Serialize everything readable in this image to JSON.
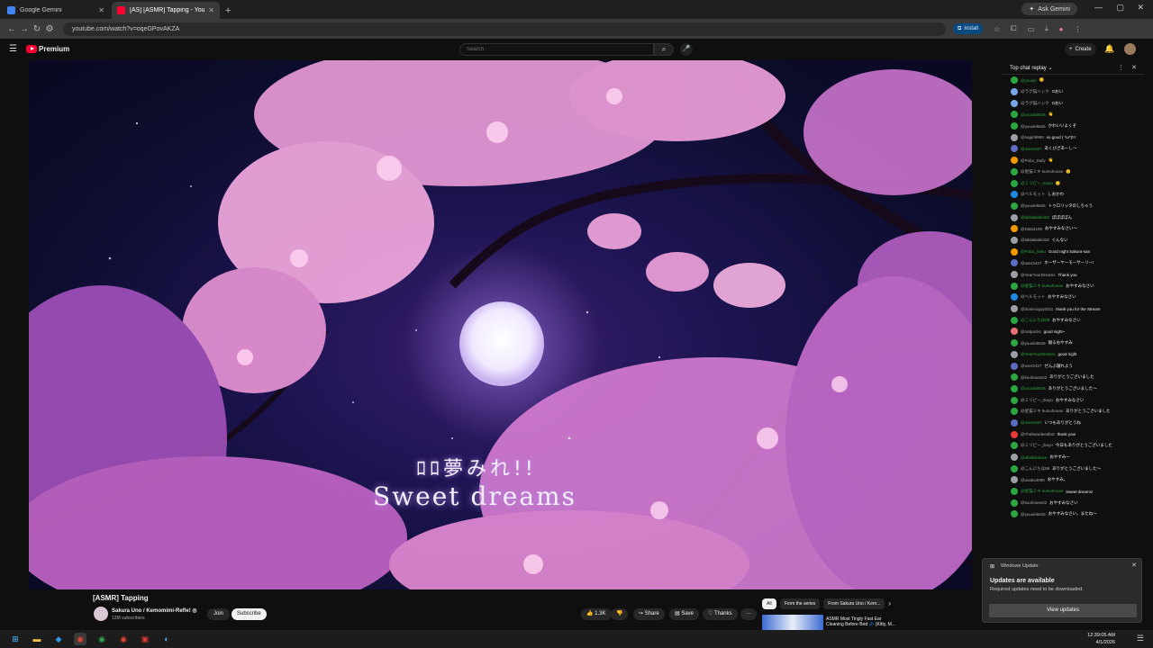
{
  "browser": {
    "tabs": [
      {
        "title": "Google Gemini",
        "color": "#4285f4",
        "active": false
      },
      {
        "title": "[AS] [ASMR] Tapping - YouTube",
        "color": "#ff0033",
        "active": true
      }
    ],
    "new_tab": "+",
    "ask_gemini": "Ask Gemini",
    "url": "youtube.com/watch?v=oqeGPovAKZA",
    "install_label": "Install"
  },
  "youtube": {
    "logo_text": "Premium",
    "search_placeholder": "Search",
    "create_label": "Create"
  },
  "video": {
    "subtitle_jp": "ﾛﾛ夢みれ!!",
    "subtitle_en": "Sweet dreams",
    "title": "[ASMR] Tapping",
    "channel": "Sakura Uno / Kemomimi-Refle!",
    "channel_badge": "◎",
    "subscribers": "12M subscribers",
    "join_label": "Join",
    "subscribe_label": "Subscribe",
    "likes": "1.3K",
    "share_label": "Share",
    "save_label": "Save",
    "thanks_label": "Thanks",
    "more_label": "···"
  },
  "recommendations": {
    "chips": [
      "All",
      "From the series",
      "From Sakura Uno / Kem..."
    ],
    "first_title": "ASMR Most Tingly Fast Ear Cleaning Before Bed 💤 [Kitty, M..."
  },
  "chat": {
    "header": "Top chat replay",
    "messages": [
      {
        "user": "@yuuuki",
        "text": "😊",
        "color": "#2ba640"
      },
      {
        "user": "@ラグ猫ハック",
        "text": "Gおい",
        "color": "#7aa4e8"
      },
      {
        "user": "@ラグ猫ハック",
        "text": "Gおい",
        "color": "#7aa4e8"
      },
      {
        "user": "@yuuuki6626",
        "text": "👋",
        "color": "#2ba640"
      },
      {
        "user": "@yuuuki6626",
        "text": "かわいいよくぞ",
        "color": "#2ba640"
      },
      {
        "user": "@nagiri9999",
        "text": "so good ( *ω*)!!!",
        "color": "#9aa0a6"
      },
      {
        "user": "@user2427",
        "text": "あくびざあーし～",
        "color": "#5c6bc0"
      },
      {
        "user": "@Pobo_Daily",
        "text": "👋",
        "color": "#f29900"
      },
      {
        "user": "@星猫ミキ kumohouse",
        "text": "😊",
        "color": "#2ba640"
      },
      {
        "user": "@ミリピー_Ikuyo",
        "text": "😊",
        "color": "#2ba640"
      },
      {
        "user": "@ベルモット",
        "text": "しおかわ",
        "color": "#1e88e5"
      },
      {
        "user": "@yuuuki6626",
        "text": "トゥロリッタのしちゃう",
        "color": "#2ba640"
      },
      {
        "user": "@lalalalalalol18",
        "text": "ぽぽぽぽん",
        "color": "#9aa0a6"
      },
      {
        "user": "@Dabi4109",
        "text": "おやすみなさい～",
        "color": "#f29900"
      },
      {
        "user": "@lalalalalalol18",
        "text": "ぐんない",
        "color": "#9aa0a6"
      },
      {
        "user": "@Pobo_Saku",
        "text": "Good night Sakura-san",
        "color": "#f29900"
      },
      {
        "user": "@user2427",
        "text": "ホーザーヤーモーサーリー!",
        "color": "#5c6bc0"
      },
      {
        "user": "@YearYourDreams",
        "text": "Thank you",
        "color": "#9aa0a6"
      },
      {
        "user": "@星猫ミキ kumohouse",
        "text": "おやすみなさい",
        "color": "#2ba640"
      },
      {
        "user": "@ベルモット",
        "text": "おやすみなさい",
        "color": "#1e88e5"
      },
      {
        "user": "@dominoguy0211",
        "text": "thank you for the Stream",
        "color": "#9aa0a6"
      },
      {
        "user": "@こんにちは98",
        "text": "おやすみなさい",
        "color": "#2ba640"
      },
      {
        "user": "@natpacks",
        "text": "good night~",
        "color": "#e57373"
      },
      {
        "user": "@yuuuki6626",
        "text": "寝るおやすみ",
        "color": "#2ba640"
      },
      {
        "user": "@YearYourDreams",
        "text": "good night",
        "color": "#9aa0a6"
      },
      {
        "user": "@user2427",
        "text": "ぜんぶ寝れよう",
        "color": "#5c6bc0"
      },
      {
        "user": "@kuuhouse22",
        "text": "ありがとうございました",
        "color": "#2ba640"
      },
      {
        "user": "@yuuuki6626",
        "text": "ありがとうございました～",
        "color": "#2ba640"
      },
      {
        "user": "@ミリピー_Ikuyo",
        "text": "おやすみなさい",
        "color": "#2ba640"
      },
      {
        "user": "@星猫ミキ kumohouse",
        "text": "ありがとうございました",
        "color": "#2ba640"
      },
      {
        "user": "@user2427",
        "text": "いつもありがとうね",
        "color": "#5c6bc0"
      },
      {
        "user": "@Thebeardeedbot",
        "text": "thank you!",
        "color": "#e53935"
      },
      {
        "user": "@ミリピー_Ikuyo",
        "text": "今日もありがとうございました",
        "color": "#2ba640"
      },
      {
        "user": "@allafinitolove",
        "text": "おやすみー",
        "color": "#9aa0a6"
      },
      {
        "user": "@こんにちは98",
        "text": "ありがとうございました～",
        "color": "#2ba640"
      },
      {
        "user": "@usako4099",
        "text": "おやすみ。",
        "color": "#9aa0a6"
      },
      {
        "user": "@星猫ミキ kumohouse",
        "text": "Sweet dreams!",
        "color": "#2ba640"
      },
      {
        "user": "@kuuhouse22",
        "text": "おやすみなさい",
        "color": "#2ba640"
      },
      {
        "user": "@yuuuki6626",
        "text": "おやすみなさい。またね～",
        "color": "#2ba640"
      }
    ]
  },
  "notification": {
    "app": "Windows Update",
    "heading": "Updates are available",
    "body": "Required updates need to be downloaded.",
    "button": "View updates"
  },
  "taskbar": {
    "time": "12:39:05 AM",
    "date": "4/1/2026"
  }
}
